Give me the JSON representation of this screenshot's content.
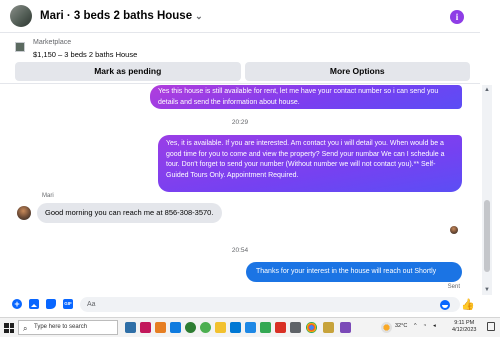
{
  "header": {
    "title": "Mari · 3 beds 2 baths House",
    "chevron": "⌄",
    "info_icon": "info-icon",
    "accent": "#8e3de6"
  },
  "marketplace": {
    "label": "Marketplace",
    "listing": "$1,150 – 3 beds 2 baths House",
    "mark_pending": "Mark as pending",
    "more_options": "More Options"
  },
  "chat": {
    "msg1": "Yes this house is still available for rent, let me have your contact number so i can send you details and send the information about house.",
    "time1": "20:29",
    "msg2": "Yes, it is available. If you are interested.  Am contact you i will detail you.  When would be a good time for you to come and view the property? Send your numbar We can I schedule a tour.  Don't forget to send your number (Without number we will not contact you).** Self-Guided Tours Only. Appointment Required.",
    "sender_name": "Mari",
    "msg3": "Good morning you can reach me at 856-308-3570.",
    "time2": "20:54",
    "msg4": "Thanks for your interest in the house will reach out Shortly",
    "status": "Sent",
    "outgoing_color": "#7b3ef0",
    "reply_color": "#1b74e4"
  },
  "composer": {
    "placeholder": "Aa",
    "gif_label": "GIF",
    "plus_label": "+",
    "like_icon": "👍"
  },
  "taskbar": {
    "search_placeholder": "Type here to search",
    "search_icon": "⌕",
    "temperature": "32°C",
    "time": "9:11 PM",
    "date": "4/12/2023"
  }
}
